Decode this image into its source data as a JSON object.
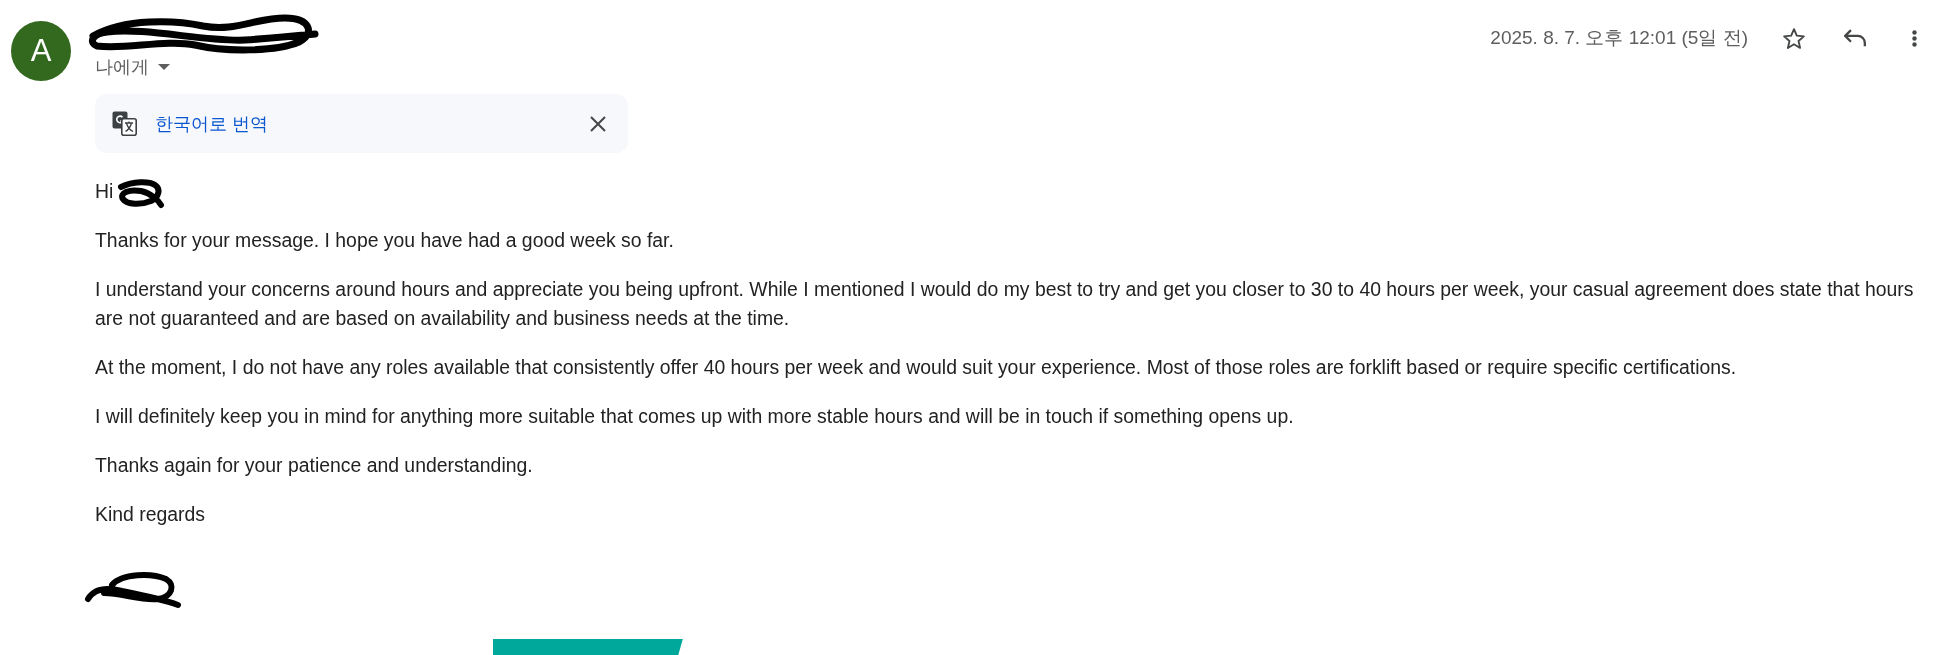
{
  "sender": {
    "avatar_letter": "A",
    "name_redacted": true,
    "recipients": "나에게",
    "date": "2025. 8. 7. 오후 12:01 (5일 전)",
    "starred": false
  },
  "translate_bar": {
    "label": "한국어로 번역"
  },
  "body": {
    "greeting": "Hi",
    "greeting_name_redacted": true,
    "paragraphs": [
      "Thanks for your message. I hope you have had a good week so far.",
      "I understand your concerns around hours and appreciate you being upfront. While I mentioned I would do my best to try and get you closer to 30 to 40 hours per week, your casual agreement does state that hours are not guaranteed and are based on availability and business needs at the time.",
      "At the moment, I do not have any roles available that consistently offer 40 hours per week and would suit your experience. Most of those roles are forklift based or require specific certifications.",
      "I will definitely keep you in mind for anything more suitable that comes up with more stable hours and will be in touch if something opens up.",
      "Thanks again for your patience and understanding.",
      "Kind regards"
    ]
  },
  "signature": {
    "name_redacted": true,
    "banner_image": true
  }
}
